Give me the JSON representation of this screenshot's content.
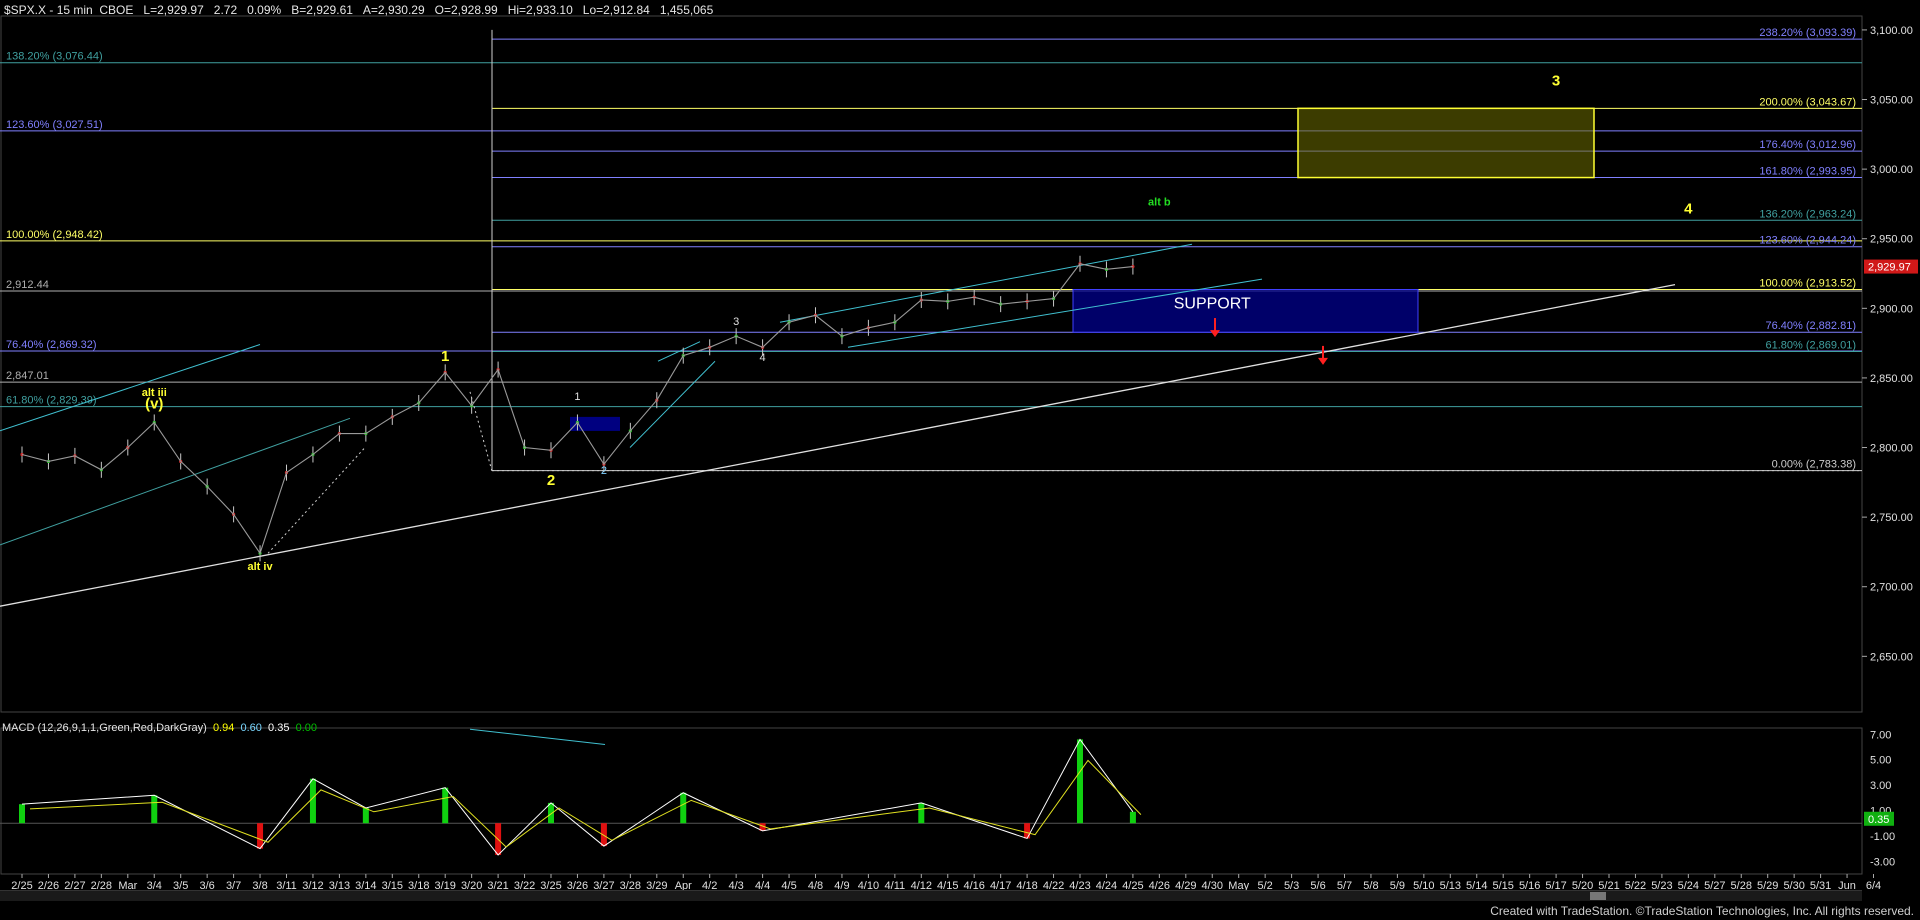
{
  "header": {
    "symbol": "$SPX.X - 15 min  CBOE",
    "last": "L=2,929.97",
    "change": "2.72",
    "pct": "0.09%",
    "bid": "B=2,929.61",
    "ask": "A=2,930.29",
    "open": "O=2,928.99",
    "high": "Hi=2,933.10",
    "low": "Lo=2,912.84",
    "volume": "1,455,065"
  },
  "macd_label": {
    "title": "MACD (12,26,9,1,1,Green,Red,DarkGray)",
    "v1": "0.94",
    "v2": "0.60",
    "v3": "0.35",
    "v4": "0.00"
  },
  "footer": "Created with TradeStation. ©TradeStation Technologies, Inc. All rights reserved.",
  "chart_data": {
    "type": "line",
    "title": "",
    "y_axis": {
      "range": [
        2610,
        3110
      ],
      "ticks": [
        2650,
        2700,
        2750,
        2800,
        2850,
        2900,
        2950,
        3000,
        3050,
        3100
      ],
      "tick_labels": [
        "2,650.00",
        "2,700.00",
        "2,750.00",
        "2,800.00",
        "2,850.00",
        "2,900.00",
        "2,950.00",
        "3,000.00",
        "3,050.00",
        "3,100.00"
      ],
      "last_price_label": "2,929.97"
    },
    "macd_axis": {
      "range": [
        -4.0,
        7.5
      ],
      "ticks": [
        7.0,
        5.0,
        3.0,
        1.0,
        -1.0,
        -3.0
      ],
      "tick_labels": [
        "7.00",
        "5.00",
        "3.00",
        "1.00",
        "-1.00",
        "-3.00"
      ],
      "last_label": "0.35"
    },
    "x_labels": [
      "2/25",
      "2/26",
      "2/27",
      "2/28",
      "Mar",
      "3/4",
      "3/5",
      "3/6",
      "3/7",
      "3/8",
      "3/11",
      "3/12",
      "3/13",
      "3/14",
      "3/15",
      "3/18",
      "3/19",
      "3/20",
      "3/21",
      "3/22",
      "3/25",
      "3/26",
      "3/27",
      "3/28",
      "3/29",
      "Apr",
      "4/2",
      "4/3",
      "4/4",
      "4/5",
      "4/8",
      "4/9",
      "4/10",
      "4/11",
      "4/12",
      "4/15",
      "4/16",
      "4/17",
      "4/18",
      "4/22",
      "4/23",
      "4/24",
      "4/25",
      "4/26",
      "4/29",
      "4/30",
      "May",
      "5/2",
      "5/3",
      "5/6",
      "5/7",
      "5/8",
      "5/9",
      "5/10",
      "5/13",
      "5/14",
      "5/15",
      "5/16",
      "5/17",
      "5/20",
      "5/21",
      "5/22",
      "5/23",
      "5/24",
      "5/27",
      "5/28",
      "5/29",
      "5/30",
      "5/31",
      "Jun",
      "6/4"
    ],
    "price_series": [
      {
        "day": "2/25",
        "value": 2795
      },
      {
        "day": "2/26",
        "value": 2790
      },
      {
        "day": "2/27",
        "value": 2794
      },
      {
        "day": "2/28",
        "value": 2784
      },
      {
        "day": "Mar",
        "value": 2800
      },
      {
        "day": "3/4",
        "value": 2818
      },
      {
        "day": "3/5",
        "value": 2790
      },
      {
        "day": "3/6",
        "value": 2772
      },
      {
        "day": "3/7",
        "value": 2752
      },
      {
        "day": "3/8",
        "value": 2724
      },
      {
        "day": "3/11",
        "value": 2782
      },
      {
        "day": "3/12",
        "value": 2795
      },
      {
        "day": "3/13",
        "value": 2810
      },
      {
        "day": "3/14",
        "value": 2810
      },
      {
        "day": "3/15",
        "value": 2822
      },
      {
        "day": "3/18",
        "value": 2832
      },
      {
        "day": "3/19",
        "value": 2854
      },
      {
        "day": "3/20",
        "value": 2830
      },
      {
        "day": "3/21",
        "value": 2856
      },
      {
        "day": "3/22",
        "value": 2800
      },
      {
        "day": "3/25",
        "value": 2798
      },
      {
        "day": "3/26",
        "value": 2818
      },
      {
        "day": "3/27",
        "value": 2788
      },
      {
        "day": "3/28",
        "value": 2812
      },
      {
        "day": "3/29",
        "value": 2834
      },
      {
        "day": "Apr",
        "value": 2866
      },
      {
        "day": "4/2",
        "value": 2872
      },
      {
        "day": "4/3",
        "value": 2880
      },
      {
        "day": "4/4",
        "value": 2872
      },
      {
        "day": "4/5",
        "value": 2890
      },
      {
        "day": "4/8",
        "value": 2895
      },
      {
        "day": "4/9",
        "value": 2880
      },
      {
        "day": "4/10",
        "value": 2886
      },
      {
        "day": "4/11",
        "value": 2890
      },
      {
        "day": "4/12",
        "value": 2906
      },
      {
        "day": "4/15",
        "value": 2905
      },
      {
        "day": "4/16",
        "value": 2908
      },
      {
        "day": "4/17",
        "value": 2903
      },
      {
        "day": "4/18",
        "value": 2905
      },
      {
        "day": "4/22",
        "value": 2907
      },
      {
        "day": "4/23",
        "value": 2932
      },
      {
        "day": "4/24",
        "value": 2928
      },
      {
        "day": "4/25",
        "value": 2930
      }
    ],
    "horizontal_levels": [
      {
        "label": "238.20% (3,093.39)",
        "value": 3093.39,
        "color": "#8080ff",
        "side": "right"
      },
      {
        "label": "138.20% (3,076.44)",
        "value": 3076.44,
        "color": "#40a0a0",
        "side": "left"
      },
      {
        "label": "200.00% (3,043.67)",
        "value": 3043.67,
        "color": "#ffff66",
        "side": "right"
      },
      {
        "label": "123.60% (3,027.51)",
        "value": 3027.51,
        "color": "#8080ff",
        "side": "left"
      },
      {
        "label": "176.40% (3,012.96)",
        "value": 3012.96,
        "color": "#8080ff",
        "side": "right"
      },
      {
        "label": "161.80% (2,993.95)",
        "value": 2993.95,
        "color": "#8080ff",
        "side": "right"
      },
      {
        "label": "136.20% (2,963.24)",
        "value": 2963.24,
        "color": "#40a0a0",
        "side": "right"
      },
      {
        "label": "100.00% (2,948.42)",
        "value": 2948.42,
        "color": "#ffff66",
        "side": "left"
      },
      {
        "label": "123.60% (2,944.24)",
        "value": 2944.24,
        "color": "#8080ff",
        "side": "right"
      },
      {
        "label": "2,912.44",
        "value": 2912.44,
        "color": "#b0b0b0",
        "side": "left"
      },
      {
        "label": "100.00% (2,913.52)",
        "value": 2913.52,
        "color": "#ffff66",
        "side": "right"
      },
      {
        "label": "76.40% (2,882.81)",
        "value": 2882.81,
        "color": "#8080ff",
        "side": "right"
      },
      {
        "label": "76.40% (2,869.32)",
        "value": 2869.32,
        "color": "#8080ff",
        "side": "left"
      },
      {
        "label": "61.80% (2,869.01)",
        "value": 2869.01,
        "color": "#40a0a0",
        "side": "right"
      },
      {
        "label": "2,847.01",
        "value": 2847.01,
        "color": "#b0b0b0",
        "side": "left"
      },
      {
        "label": "61.80% (2,829.39)",
        "value": 2829.39,
        "color": "#40a0a0",
        "side": "left"
      },
      {
        "label": "0.00% (2,783.38)",
        "value": 2783.38,
        "color": "#cccccc",
        "side": "right"
      }
    ],
    "annotations": [
      {
        "text": "3",
        "color": "#ffff33",
        "day": "5/17",
        "value": 3060
      },
      {
        "text": "alt b",
        "color": "#22dd22",
        "day": "4/26",
        "value": 2974
      },
      {
        "text": "4",
        "color": "#ffff33",
        "day": "5/24",
        "value": 2968
      },
      {
        "text": "SUPPORT",
        "color": "#ffffff",
        "day": "4/30",
        "value": 2900
      },
      {
        "text": "1",
        "color": "#ffff33",
        "day": "3/19",
        "value": 2862
      },
      {
        "text": "alt iii",
        "color": "#ffff33",
        "day": "3/4",
        "value": 2837
      },
      {
        "text": "(v)",
        "color": "#ffff33",
        "day": "3/4",
        "value": 2828
      },
      {
        "text": "2",
        "color": "#ffff33",
        "day": "3/25",
        "value": 2773
      },
      {
        "text": "alt iv",
        "color": "#ffff33",
        "day": "3/8",
        "value": 2712
      },
      {
        "text": "1",
        "color": "#e0e0e0",
        "day": "3/26",
        "value": 2834
      },
      {
        "text": "2",
        "color": "#80d0ff",
        "day": "3/27",
        "value": 2781
      },
      {
        "text": "3",
        "color": "#e0e0e0",
        "day": "4/3",
        "value": 2888
      },
      {
        "text": "4",
        "color": "#e0e0e0",
        "day": "4/4",
        "value": 2862
      }
    ],
    "macd_series": [
      {
        "day": "2/25",
        "value": 1.5
      },
      {
        "day": "3/4",
        "value": 2.2
      },
      {
        "day": "3/8",
        "value": -2.0
      },
      {
        "day": "3/12",
        "value": 3.5
      },
      {
        "day": "3/14",
        "value": 1.2
      },
      {
        "day": "3/19",
        "value": 2.8
      },
      {
        "day": "3/21",
        "value": -2.5
      },
      {
        "day": "3/25",
        "value": 1.6
      },
      {
        "day": "3/27",
        "value": -1.8
      },
      {
        "day": "Apr",
        "value": 2.4
      },
      {
        "day": "4/4",
        "value": -0.6
      },
      {
        "day": "4/12",
        "value": 1.6
      },
      {
        "day": "4/18",
        "value": -1.2
      },
      {
        "day": "4/23",
        "value": 6.6
      },
      {
        "day": "4/25",
        "value": 0.9
      }
    ]
  }
}
